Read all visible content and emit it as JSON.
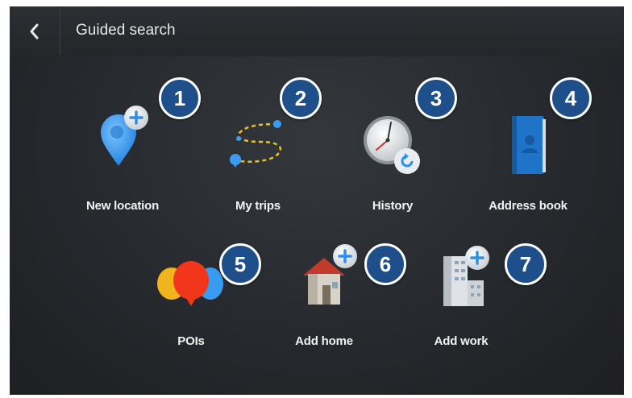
{
  "header": {
    "back_icon": "chevron-left-icon",
    "title": "Guided search"
  },
  "tiles": [
    {
      "label": "New location",
      "icon": "location-pin-add-icon",
      "badge": "1"
    },
    {
      "label": "My trips",
      "icon": "route-trips-icon",
      "badge": "2"
    },
    {
      "label": "History",
      "icon": "clock-history-icon",
      "badge": "3"
    },
    {
      "label": "Address book",
      "icon": "address-book-icon",
      "badge": "4"
    },
    {
      "label": "POIs",
      "icon": "poi-balloons-icon",
      "badge": "5"
    },
    {
      "label": "Add home",
      "icon": "house-add-icon",
      "badge": "6"
    },
    {
      "label": "Add work",
      "icon": "office-building-add-icon",
      "badge": "7"
    }
  ],
  "colors": {
    "badge_fill": "#1f4f8a",
    "badge_border": "#ffffff",
    "accent_blue": "#2f8fe8",
    "background": "#26292d"
  }
}
